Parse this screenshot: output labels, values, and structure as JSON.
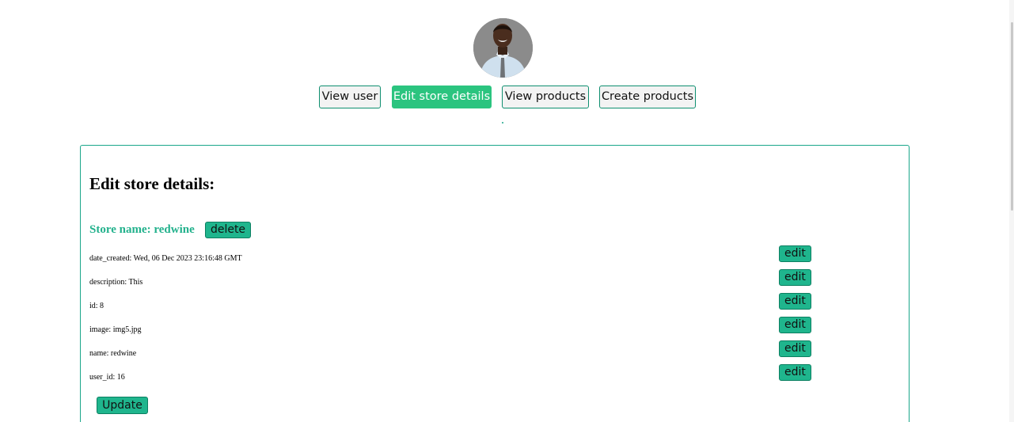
{
  "nav": {
    "buttons": [
      {
        "label": "View user",
        "active": false
      },
      {
        "label": "Edit store details",
        "active": true
      },
      {
        "label": "View products",
        "active": false
      },
      {
        "label": "Create products",
        "active": false
      }
    ]
  },
  "panel": {
    "title": "Edit store details:",
    "store_name": "Store name: redwine",
    "delete_label": "delete",
    "fields": [
      {
        "text": "date_created: Wed, 06 Dec 2023 23:16:48 GMT",
        "edit_label": "edit"
      },
      {
        "text": "description: This",
        "edit_label": "edit"
      },
      {
        "text": "id: 8",
        "edit_label": "edit"
      },
      {
        "text": "image: img5.jpg",
        "edit_label": "edit"
      },
      {
        "text": "name: redwine",
        "edit_label": "edit"
      },
      {
        "text": "user_id: 16",
        "edit_label": "edit"
      }
    ],
    "update_label": "Update"
  },
  "colors": {
    "accent": "#1fb58d",
    "active_nav": "#2bc47f",
    "border": "#1aa68a",
    "store_name": "#22b18c"
  },
  "icons": {
    "profile": "avatar-photo"
  }
}
